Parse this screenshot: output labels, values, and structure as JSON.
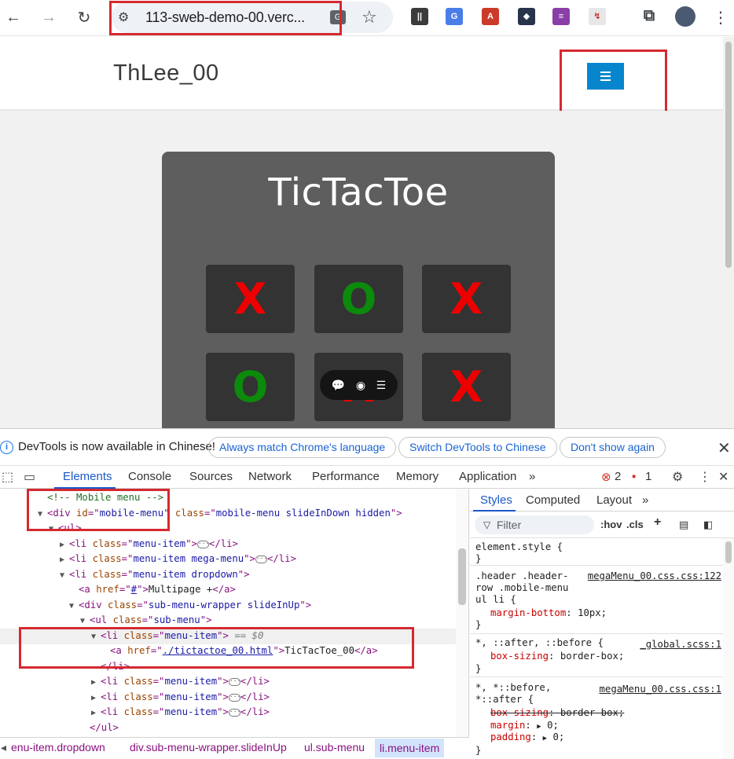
{
  "browser": {
    "url": "113-sweb-demo-00.verc...",
    "extensions": [
      {
        "icon": "audio-wave-extension-icon",
        "color": "#3b3b3b",
        "glyph": "||"
      },
      {
        "icon": "google-translate-extension-icon",
        "color": "#4a7de8",
        "glyph": "G"
      },
      {
        "icon": "pdf-extension-icon",
        "color": "#cc3a2a",
        "glyph": "A"
      },
      {
        "icon": "cube-extension-icon",
        "color": "#27344a",
        "glyph": "◆"
      },
      {
        "icon": "list-extension-icon",
        "color": "#8a3fa7",
        "glyph": "≡"
      },
      {
        "icon": "document-extension-icon",
        "color": "#e7e7e7",
        "glyph": "↯"
      }
    ]
  },
  "site": {
    "logo": "ThLee_00",
    "game": {
      "title": "TicTacToe",
      "cells": [
        {
          "mark": "x",
          "label": "X"
        },
        {
          "mark": "o",
          "label": "O"
        },
        {
          "mark": "x",
          "label": "X"
        },
        {
          "mark": "o",
          "label": "O"
        },
        {
          "mark": "x",
          "label": "X"
        },
        {
          "mark": "x",
          "label": "X"
        }
      ]
    }
  },
  "devtools": {
    "notice": {
      "message": "DevTools is now available in Chinese!",
      "btn_match": "Always match Chrome's language",
      "btn_switch": "Switch DevTools to Chinese",
      "btn_dismiss": "Don't show again"
    },
    "tabs": [
      "Elements",
      "Console",
      "Sources",
      "Network",
      "Performance",
      "Memory",
      "Application"
    ],
    "errors": "2",
    "issues": "1",
    "code": {
      "comment": "<!-- Mobile menu -->",
      "div_id": "mobile-menu",
      "div_class": "mobile-menu slideInDown hidden",
      "li1_class": "menu-item",
      "li2_class": "menu-item mega-menu",
      "li3_class": "menu-item dropdown",
      "a_href": "#",
      "a_text": "Multipage +",
      "wrapper_class": "sub-menu-wrapper slideInUp",
      "ul_class": "sub-menu",
      "sel_li_class": "menu-item",
      "sel_hint": "== $0",
      "ttt_href": "./tictactoe_00.html",
      "ttt_text": "TicTacToe_00",
      "li4_class": "menu-item",
      "li5_class": "menu-item",
      "li6_class": "menu-item"
    },
    "breadcrumbs": [
      "enu-item.dropdown",
      "div.sub-menu-wrapper.slideInUp",
      "ul.sub-menu",
      "li.menu-item"
    ],
    "styles": {
      "tabs": [
        "Styles",
        "Computed",
        "Layout"
      ],
      "filter_placeholder": "Filter",
      "hov": ":hov",
      "cls": ".cls",
      "rules": {
        "r0_selector": "element.style {",
        "r1_selector": ".header .header-\nrow .mobile-menu\nul li {",
        "r1_source": "megaMenu_00.css.css:122",
        "r1_prop": "margin-bottom",
        "r1_value": "10px;",
        "r2_selector": "*, ::after, ::before {",
        "r2_source": "_global.scss:1",
        "r2_prop": "box-sizing",
        "r2_value": "border-box;",
        "r3_selector": "*, *::before,\n*::after {",
        "r3_source": "megaMenu_00.css.css:1",
        "r3_p1": "box-sizing",
        "r3_v1": "border-box;",
        "r3_p2": "margin",
        "r3_v2": "0;",
        "r3_p3": "padding",
        "r3_v3": "0;"
      }
    }
  }
}
